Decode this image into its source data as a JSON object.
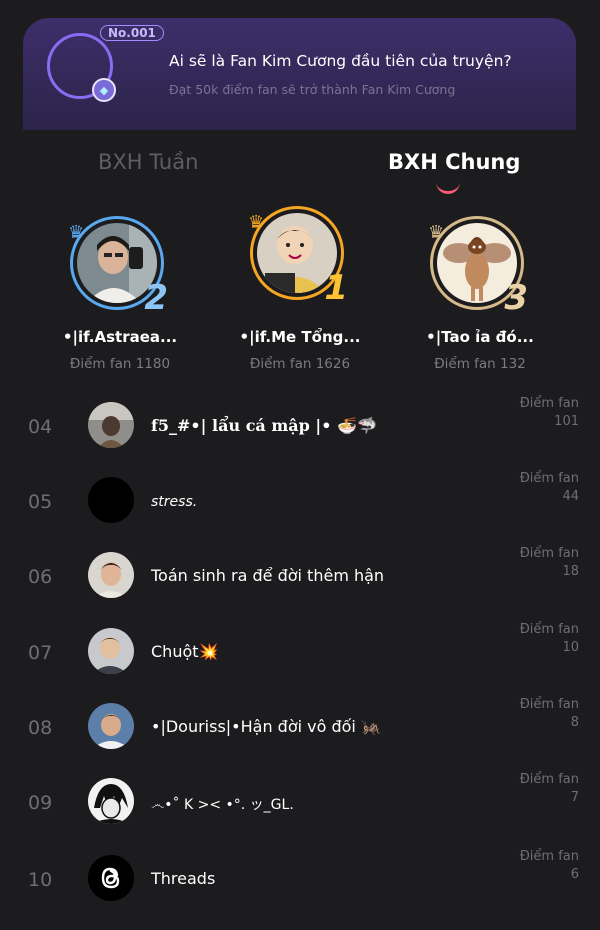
{
  "banner": {
    "badge": "No.001",
    "title": "Ai sẽ là Fan Kim Cương đầu tiên của truyện?",
    "subtitle": "Đạt 50k điểm fan sẽ trở thành Fan Kim Cương"
  },
  "tabs": {
    "weekly": "BXH Tuần",
    "general": "BXH Chung",
    "active": "general"
  },
  "podium": [
    {
      "rank": "2",
      "name": "•|if.Astraea...",
      "score": "Điểm fan 1180",
      "ring": "#5aa8ee"
    },
    {
      "rank": "1",
      "name": "•|if.Me Tổng...",
      "score": "Điểm fan 1626",
      "ring": "#f5a623"
    },
    {
      "rank": "3",
      "name": "•|Tao ỉa đó...",
      "score": "Điểm fan 132",
      "ring": "#d6b98a"
    }
  ],
  "score_label": "Điểm fan",
  "ranking": [
    {
      "rank": "04",
      "name": "f5_#•| lẩu cá mập |• 🍜🦈",
      "score": "101"
    },
    {
      "rank": "05",
      "name": "stress.",
      "score": "44"
    },
    {
      "rank": "06",
      "name": "Toán sinh ra để đời thêm hận",
      "score": "18"
    },
    {
      "rank": "07",
      "name": "Chuột💥",
      "score": "10"
    },
    {
      "rank": "08",
      "name": "•|Douriss|•Hận đời vô đối 🦗",
      "score": "8"
    },
    {
      "rank": "09",
      "name": "෴•˚ K >< •°. ッ_GL.",
      "score": "7"
    },
    {
      "rank": "10",
      "name": "Threads",
      "score": "6"
    }
  ],
  "colors": {
    "accent": "#ff5a78",
    "banner_ring": "#8a6cf2"
  }
}
